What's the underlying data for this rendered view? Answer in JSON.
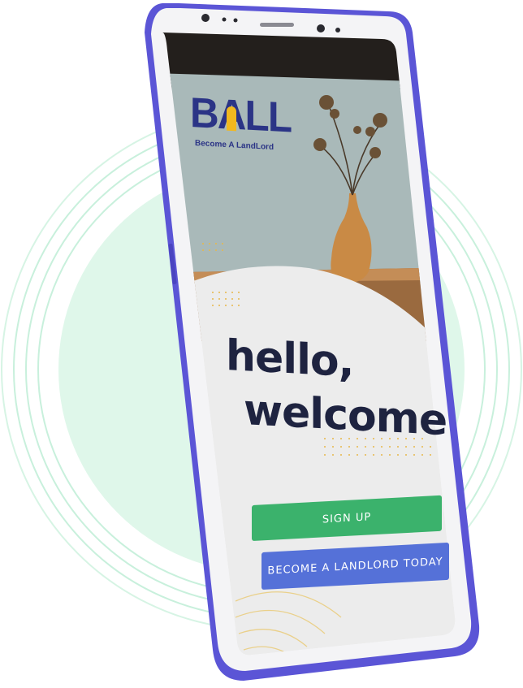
{
  "brand": {
    "name": "BALL",
    "tagline": "Become A LandLord",
    "primary_color": "#2b3486",
    "accent_color": "#f1b81f"
  },
  "hero": {
    "line1": "hello,",
    "line2": "welcome"
  },
  "actions": {
    "signup_label": "SIGN UP",
    "landlord_label": "BECOME A LANDLORD TODAY"
  },
  "colors": {
    "signup_button": "#3bb26c",
    "landlord_button": "#5571d8",
    "phone_frame": "#5b55d6",
    "background_disc": "#dff7ea",
    "heading": "#1e2340"
  },
  "icons": {
    "vase": "vase-photo-icon",
    "door": "door-icon"
  }
}
